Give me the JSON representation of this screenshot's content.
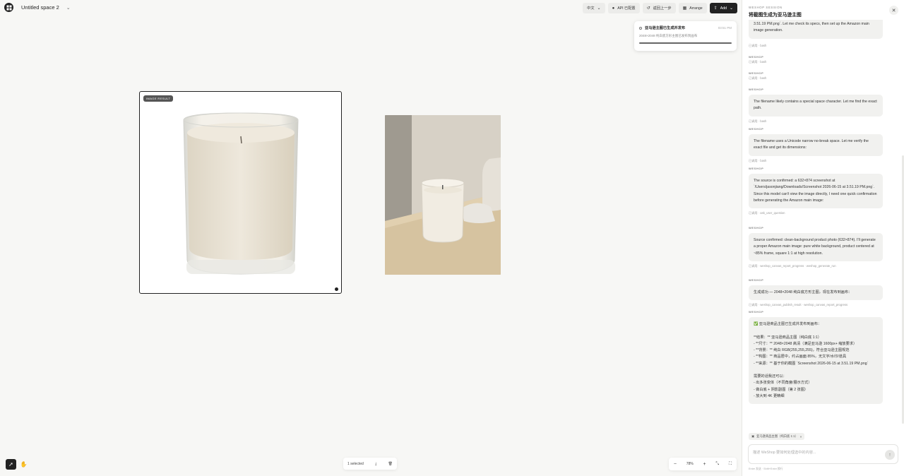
{
  "header": {
    "space_title": "Untitled space 2",
    "lang": "中文",
    "api_btn": "API 已配置",
    "undo_btn": "返回上一步",
    "arrange_btn": "Arrange",
    "add_btn": "Add"
  },
  "toast": {
    "title": "亚马逊主图已生成并发布",
    "time": "03:51 PM",
    "subtitle": "2048×2048 纯白底方形主图已发布到画布",
    "progress": 1.0
  },
  "canvas": {
    "badge": "IMAGE RESULT",
    "selected_label": "1 selected",
    "zoom_level": "78%"
  },
  "panel": {
    "kicker": "WESHOP SESSION",
    "title": "将截图生成为亚马逊主图",
    "top_bubble": "3.51.19 PM.png`. Let me check its specs, then set up the Amazon main image generation.",
    "items": [
      {
        "who": "WESHOP",
        "used": "已调用 · bash"
      },
      {
        "who": "WESHOP",
        "used": "已调用 · bash"
      },
      {
        "who": "WESHOP",
        "used": "已调用 · bash"
      },
      {
        "who": "WESHOP",
        "text": "The filename likely contains a special space character. Let me find the exact path.",
        "used": "已调用 · bash"
      },
      {
        "who": "WESHOP",
        "text": "The filename uses a Unicode narrow no-break space. Let me verify the exact file and get its dimensions:",
        "used": "已调用 · bash"
      },
      {
        "who": "WESHOP",
        "text": "The source is confirmed: a 632×874 screenshot at `/Users/jasonjiang/Downloads/Screenshot 2026-06-15 at 3.51.19 PM.png`. Since this model can't view the image directly, I need one quick confirmation before generating the Amazon main image:",
        "used": "已调用 · ask_user_question"
      },
      {
        "who": "WESHOP",
        "text": "Source confirmed: clean-background product photo (632×874). I'll generate a proper Amazon main image: pure white background, product centered at ~85% frame, square 1:1 at high resolution.",
        "used": "已调用 · weshop_canvas_report_progress · weshop_generate_run"
      },
      {
        "who": "WESHOP",
        "text": "生成成功 — 2048×2048 纯白底方形主图，现在发布到画布：",
        "used": "已调用 · weshop_canvas_publish_result · weshop_canvas_report_progress"
      },
      {
        "who": "WESHOP",
        "text": "✅ 亚马逊商品主图已生成并发布到画布：\n\n**结果：** 亚马逊商品主图（纯白底 1:1）\n- **尺寸：** 2048×2048 高清（满足亚马逊 1600px+ 缩放要求）\n- **背景：** 纯白 RGB(255,255,255)，符合亚马逊主图规范\n- **构图：** 商品居中，约占画面 85%，无文字/水印/道具\n- **来源：** 基于你的截图 `Screenshot 2026-06-15 at 3.51.19 PM.png`\n\n需要的话我还可以：\n- 出多张变体（不同角度/展示方式）\n- 做白底 + 阴影副图（第 2 张图）\n- 放大到 4K 更精细"
      }
    ],
    "chip": "亚马逊商品主图（纯白底 1:1）",
    "composer_placeholder": "描述 WeShop 要如何处理选中的内容...",
    "hint": "Enter 发送 · Shift+Enter 换行"
  },
  "colors": {
    "accent": "#222222",
    "panel_bg": "#ffffff",
    "canvas_bg": "#f7f7f5",
    "bubble_bg": "#f1f1ef"
  },
  "icons": [
    "app-logo-icon",
    "chevron-down-icon",
    "api-icon",
    "undo-icon",
    "arrange-icon",
    "upload-icon",
    "close-icon",
    "select-tool-icon",
    "hand-tool-icon",
    "download-icon",
    "trash-icon",
    "zoom-out-icon",
    "zoom-in-icon",
    "fit-icon",
    "fullscreen-icon",
    "send-icon"
  ]
}
